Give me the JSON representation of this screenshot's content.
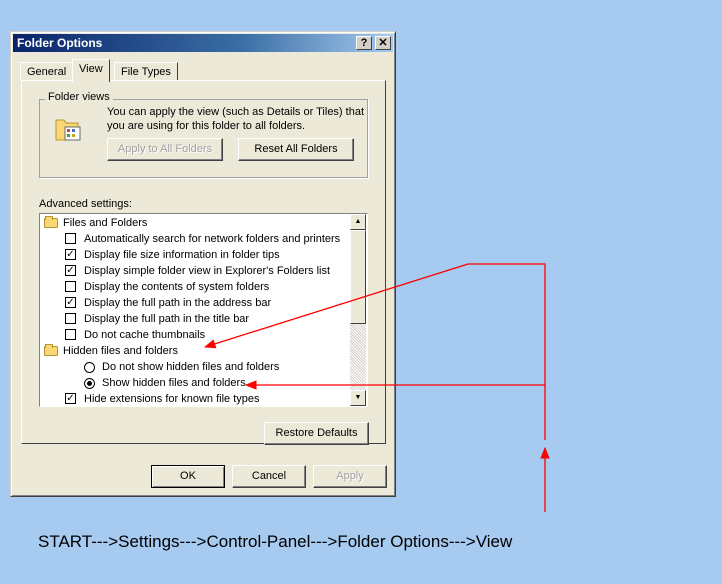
{
  "window": {
    "title": "Folder Options",
    "help_label": "?",
    "close_label": "✕"
  },
  "tabs": [
    {
      "label": "General",
      "active": false
    },
    {
      "label": "View",
      "active": true
    },
    {
      "label": "File Types",
      "active": false
    }
  ],
  "folder_views": {
    "legend": "Folder views",
    "description": "You can apply the view (such as Details or Tiles) that you are using for this folder to all folders.",
    "apply_label": "Apply to All Folders",
    "reset_label": "Reset All Folders"
  },
  "advanced": {
    "label": "Advanced settings:",
    "items": [
      {
        "type": "folder",
        "label": "Files and Folders"
      },
      {
        "type": "checkbox",
        "checked": false,
        "label": "Automatically search for network folders and printers"
      },
      {
        "type": "checkbox",
        "checked": true,
        "label": "Display file size information in folder tips"
      },
      {
        "type": "checkbox",
        "checked": true,
        "label": "Display simple folder view in Explorer's Folders list"
      },
      {
        "type": "checkbox",
        "checked": false,
        "label": "Display the contents of system folders"
      },
      {
        "type": "checkbox",
        "checked": true,
        "label": "Display the full path in the address bar"
      },
      {
        "type": "checkbox",
        "checked": false,
        "label": "Display the full path in the title bar"
      },
      {
        "type": "checkbox",
        "checked": false,
        "label": "Do not cache thumbnails"
      },
      {
        "type": "folder",
        "label": "Hidden files and folders"
      },
      {
        "type": "radio",
        "checked": false,
        "label": "Do not show hidden files and folders"
      },
      {
        "type": "radio",
        "checked": true,
        "label": "Show hidden files and folders"
      },
      {
        "type": "checkbox",
        "checked": true,
        "label": "Hide extensions for known file types"
      }
    ],
    "check_glyph": "✓",
    "scroll_up_glyph": "▲",
    "scroll_down_glyph": "▼"
  },
  "restore_label": "Restore Defaults",
  "footer": {
    "ok_label": "OK",
    "cancel_label": "Cancel",
    "apply_label": "Apply"
  },
  "caption": "START--->Settings--->Control-Panel--->Folder Options--->View",
  "colors": {
    "desktop": "#a6caf0",
    "titlebar": "#0a246a",
    "arrow": "#ff0000"
  }
}
